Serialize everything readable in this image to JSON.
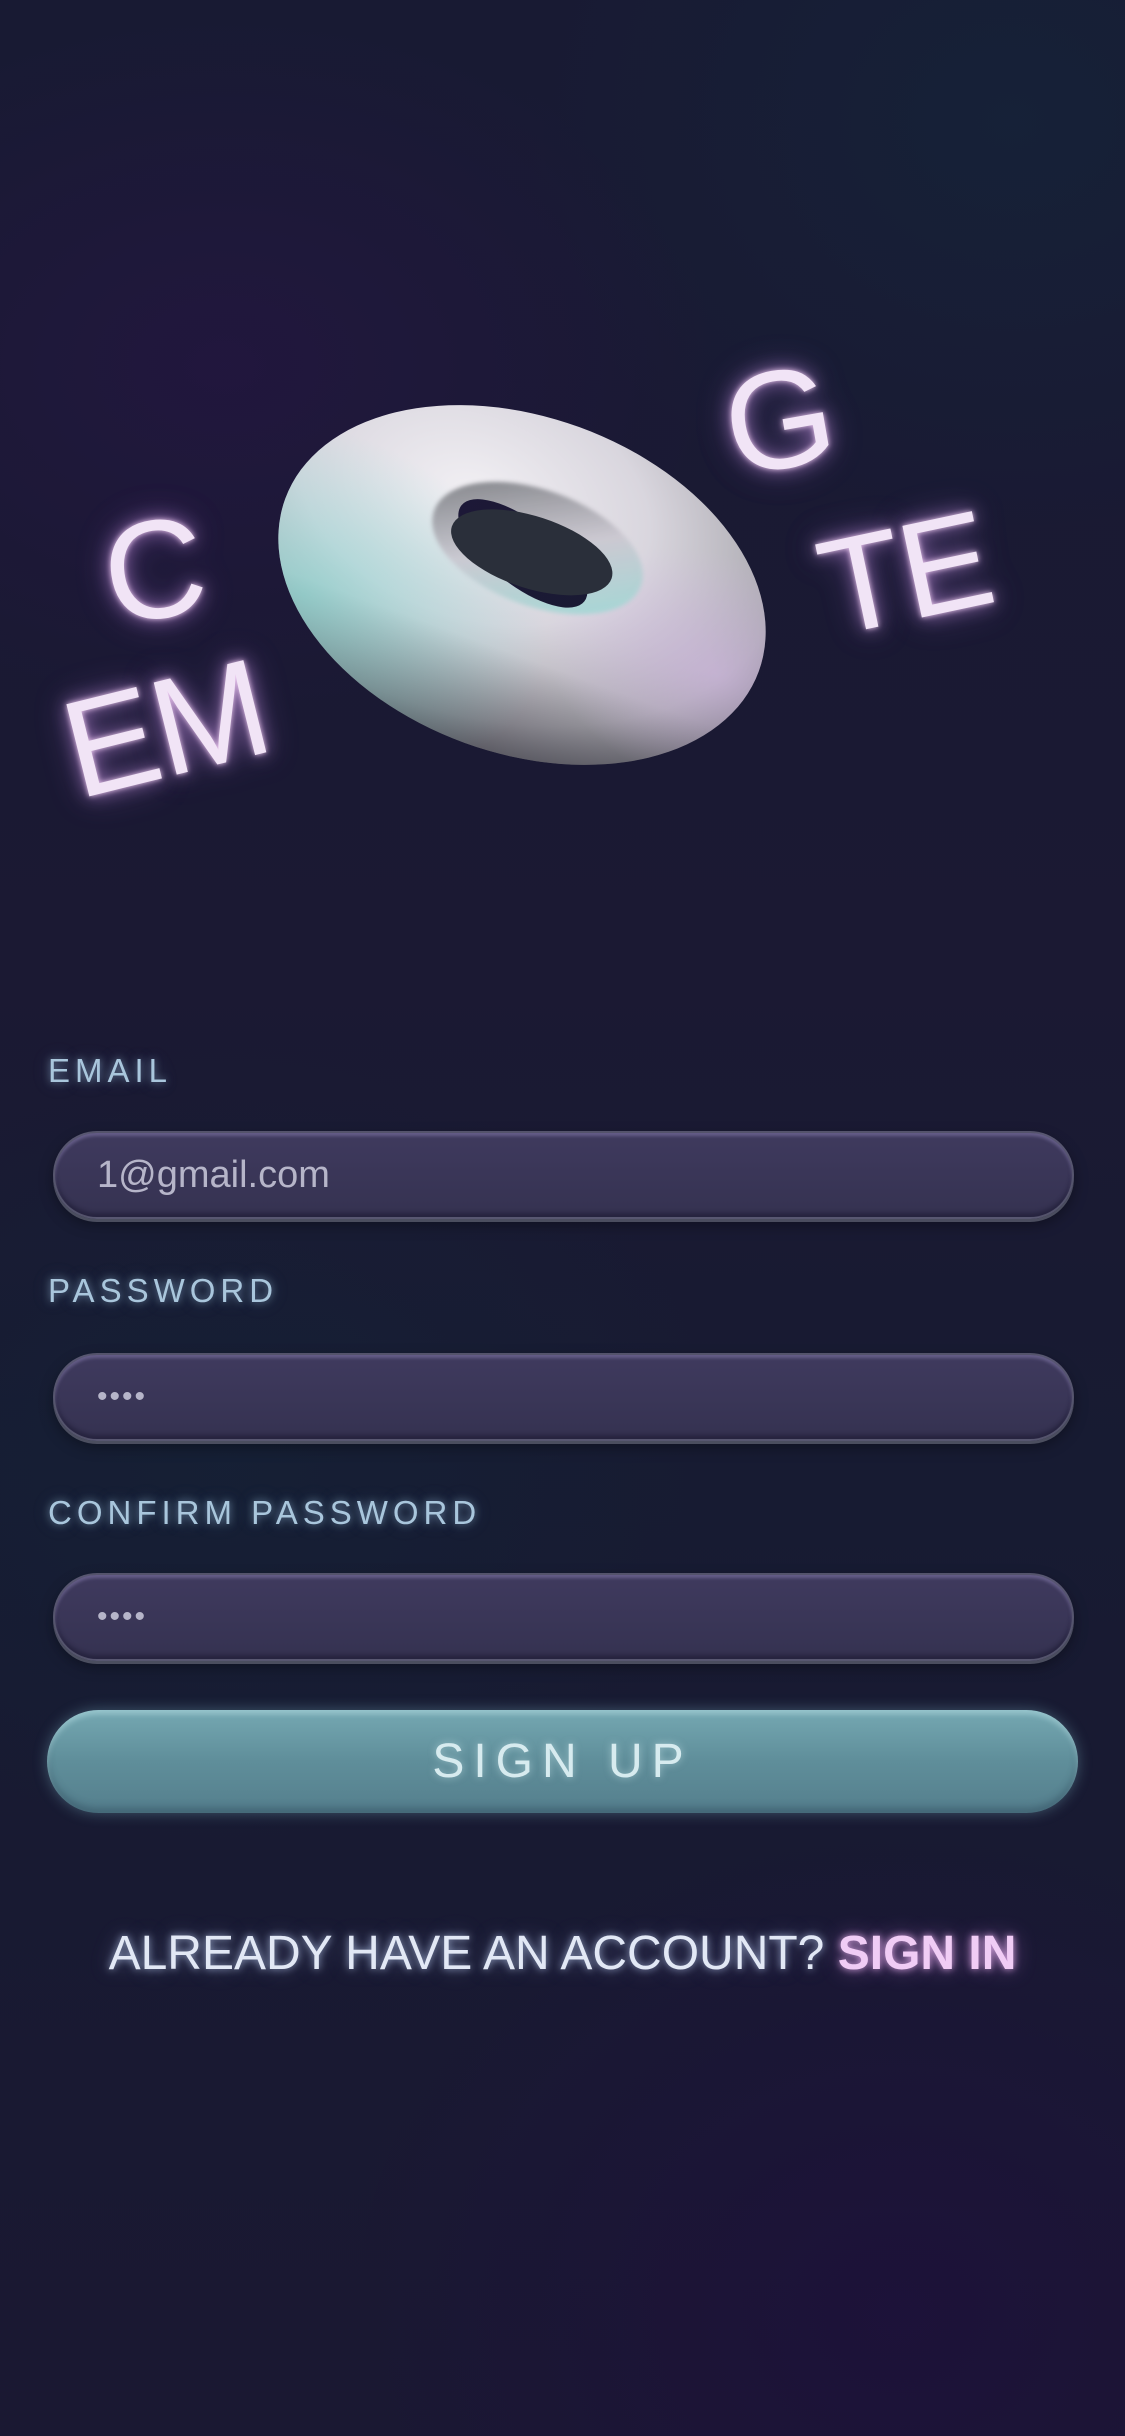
{
  "logo": {
    "letters": {
      "c": "C",
      "em": "EM",
      "g": "G",
      "te": "TE"
    },
    "torus_icon": "torus-3d-icon"
  },
  "form": {
    "email": {
      "label": "EMAIL",
      "value": "1@gmail.com"
    },
    "password": {
      "label": "PASSWORD",
      "value": "••••"
    },
    "confirm_password": {
      "label": "CONFIRM PASSWORD",
      "value": "••••"
    },
    "submit_label": "SIGN UP"
  },
  "footer": {
    "prompt": "ALREADY HAVE AN ACCOUNT?",
    "link_label": "SIGN IN"
  },
  "colors": {
    "label": "#a9c6dc",
    "input_bg": "#3b3759",
    "button_bg": "#6a9aa6",
    "link": "#f0ccf5"
  }
}
